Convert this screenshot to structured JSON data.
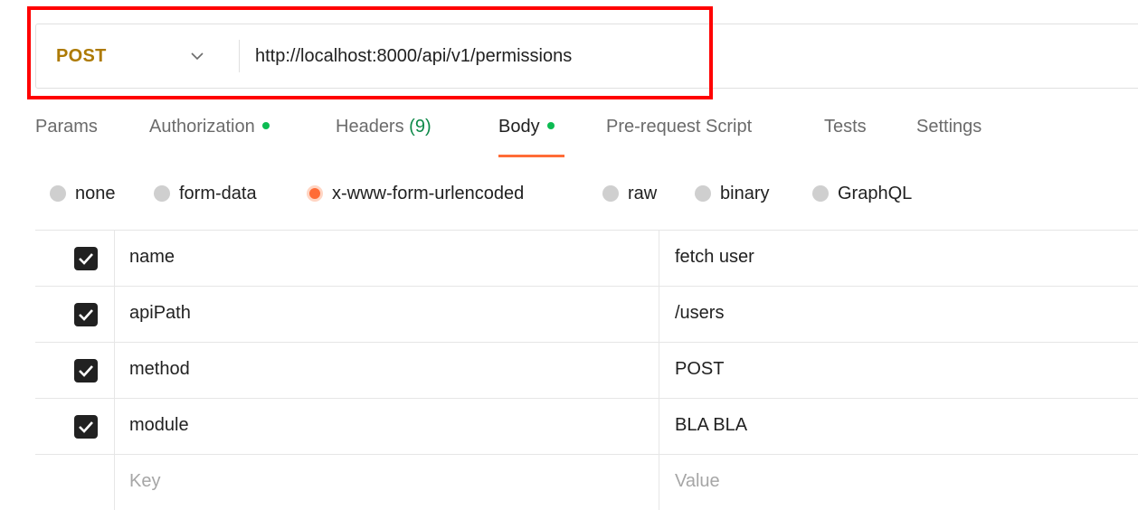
{
  "request": {
    "method": "POST",
    "url": "http://localhost:8000/api/v1/permissions"
  },
  "tabs": [
    {
      "label": "Params"
    },
    {
      "label": "Authorization",
      "dot": true
    },
    {
      "label": "Headers",
      "count": "(9)"
    },
    {
      "label": "Body",
      "dot": true,
      "active": true
    },
    {
      "label": "Pre-request Script"
    },
    {
      "label": "Tests"
    },
    {
      "label": "Settings"
    }
  ],
  "body_types": [
    {
      "label": "none"
    },
    {
      "label": "form-data"
    },
    {
      "label": "x-www-form-urlencoded",
      "selected": true
    },
    {
      "label": "raw"
    },
    {
      "label": "binary"
    },
    {
      "label": "GraphQL"
    }
  ],
  "params": [
    {
      "key": "name",
      "value": "fetch user",
      "checked": true
    },
    {
      "key": "apiPath",
      "value": "/users",
      "checked": true
    },
    {
      "key": "method",
      "value": "POST",
      "checked": true
    },
    {
      "key": "module",
      "value": "BLA BLA",
      "checked": true
    }
  ],
  "new_row": {
    "key_placeholder": "Key",
    "value_placeholder": "Value"
  },
  "colors": {
    "method": "#ad7a03",
    "accent": "#ff6c37",
    "dot": "#0cbb52",
    "highlight": "#ff0000"
  }
}
